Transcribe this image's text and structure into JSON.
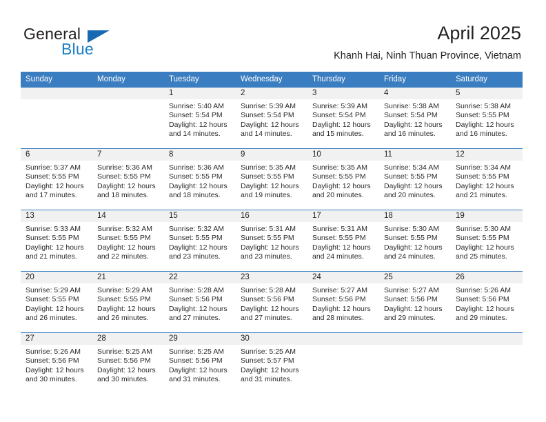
{
  "brand": {
    "name_top": "General",
    "name_bottom": "Blue",
    "color_dark": "#231f20",
    "color_blue": "#1b7fc4"
  },
  "header": {
    "title": "April 2025",
    "subtitle": "Khanh Hai, Ninh Thuan Province, Vietnam",
    "accent_color": "#3a7dc0"
  },
  "weekday_headers": [
    "Sunday",
    "Monday",
    "Tuesday",
    "Wednesday",
    "Thursday",
    "Friday",
    "Saturday"
  ],
  "weeks": [
    [
      {
        "day": "",
        "lines": []
      },
      {
        "day": "",
        "lines": []
      },
      {
        "day": "1",
        "lines": [
          "Sunrise: 5:40 AM",
          "Sunset: 5:54 PM",
          "Daylight: 12 hours",
          "and 14 minutes."
        ]
      },
      {
        "day": "2",
        "lines": [
          "Sunrise: 5:39 AM",
          "Sunset: 5:54 PM",
          "Daylight: 12 hours",
          "and 14 minutes."
        ]
      },
      {
        "day": "3",
        "lines": [
          "Sunrise: 5:39 AM",
          "Sunset: 5:54 PM",
          "Daylight: 12 hours",
          "and 15 minutes."
        ]
      },
      {
        "day": "4",
        "lines": [
          "Sunrise: 5:38 AM",
          "Sunset: 5:54 PM",
          "Daylight: 12 hours",
          "and 16 minutes."
        ]
      },
      {
        "day": "5",
        "lines": [
          "Sunrise: 5:38 AM",
          "Sunset: 5:55 PM",
          "Daylight: 12 hours",
          "and 16 minutes."
        ]
      }
    ],
    [
      {
        "day": "6",
        "lines": [
          "Sunrise: 5:37 AM",
          "Sunset: 5:55 PM",
          "Daylight: 12 hours",
          "and 17 minutes."
        ]
      },
      {
        "day": "7",
        "lines": [
          "Sunrise: 5:36 AM",
          "Sunset: 5:55 PM",
          "Daylight: 12 hours",
          "and 18 minutes."
        ]
      },
      {
        "day": "8",
        "lines": [
          "Sunrise: 5:36 AM",
          "Sunset: 5:55 PM",
          "Daylight: 12 hours",
          "and 18 minutes."
        ]
      },
      {
        "day": "9",
        "lines": [
          "Sunrise: 5:35 AM",
          "Sunset: 5:55 PM",
          "Daylight: 12 hours",
          "and 19 minutes."
        ]
      },
      {
        "day": "10",
        "lines": [
          "Sunrise: 5:35 AM",
          "Sunset: 5:55 PM",
          "Daylight: 12 hours",
          "and 20 minutes."
        ]
      },
      {
        "day": "11",
        "lines": [
          "Sunrise: 5:34 AM",
          "Sunset: 5:55 PM",
          "Daylight: 12 hours",
          "and 20 minutes."
        ]
      },
      {
        "day": "12",
        "lines": [
          "Sunrise: 5:34 AM",
          "Sunset: 5:55 PM",
          "Daylight: 12 hours",
          "and 21 minutes."
        ]
      }
    ],
    [
      {
        "day": "13",
        "lines": [
          "Sunrise: 5:33 AM",
          "Sunset: 5:55 PM",
          "Daylight: 12 hours",
          "and 21 minutes."
        ]
      },
      {
        "day": "14",
        "lines": [
          "Sunrise: 5:32 AM",
          "Sunset: 5:55 PM",
          "Daylight: 12 hours",
          "and 22 minutes."
        ]
      },
      {
        "day": "15",
        "lines": [
          "Sunrise: 5:32 AM",
          "Sunset: 5:55 PM",
          "Daylight: 12 hours",
          "and 23 minutes."
        ]
      },
      {
        "day": "16",
        "lines": [
          "Sunrise: 5:31 AM",
          "Sunset: 5:55 PM",
          "Daylight: 12 hours",
          "and 23 minutes."
        ]
      },
      {
        "day": "17",
        "lines": [
          "Sunrise: 5:31 AM",
          "Sunset: 5:55 PM",
          "Daylight: 12 hours",
          "and 24 minutes."
        ]
      },
      {
        "day": "18",
        "lines": [
          "Sunrise: 5:30 AM",
          "Sunset: 5:55 PM",
          "Daylight: 12 hours",
          "and 24 minutes."
        ]
      },
      {
        "day": "19",
        "lines": [
          "Sunrise: 5:30 AM",
          "Sunset: 5:55 PM",
          "Daylight: 12 hours",
          "and 25 minutes."
        ]
      }
    ],
    [
      {
        "day": "20",
        "lines": [
          "Sunrise: 5:29 AM",
          "Sunset: 5:55 PM",
          "Daylight: 12 hours",
          "and 26 minutes."
        ]
      },
      {
        "day": "21",
        "lines": [
          "Sunrise: 5:29 AM",
          "Sunset: 5:55 PM",
          "Daylight: 12 hours",
          "and 26 minutes."
        ]
      },
      {
        "day": "22",
        "lines": [
          "Sunrise: 5:28 AM",
          "Sunset: 5:56 PM",
          "Daylight: 12 hours",
          "and 27 minutes."
        ]
      },
      {
        "day": "23",
        "lines": [
          "Sunrise: 5:28 AM",
          "Sunset: 5:56 PM",
          "Daylight: 12 hours",
          "and 27 minutes."
        ]
      },
      {
        "day": "24",
        "lines": [
          "Sunrise: 5:27 AM",
          "Sunset: 5:56 PM",
          "Daylight: 12 hours",
          "and 28 minutes."
        ]
      },
      {
        "day": "25",
        "lines": [
          "Sunrise: 5:27 AM",
          "Sunset: 5:56 PM",
          "Daylight: 12 hours",
          "and 29 minutes."
        ]
      },
      {
        "day": "26",
        "lines": [
          "Sunrise: 5:26 AM",
          "Sunset: 5:56 PM",
          "Daylight: 12 hours",
          "and 29 minutes."
        ]
      }
    ],
    [
      {
        "day": "27",
        "lines": [
          "Sunrise: 5:26 AM",
          "Sunset: 5:56 PM",
          "Daylight: 12 hours",
          "and 30 minutes."
        ]
      },
      {
        "day": "28",
        "lines": [
          "Sunrise: 5:25 AM",
          "Sunset: 5:56 PM",
          "Daylight: 12 hours",
          "and 30 minutes."
        ]
      },
      {
        "day": "29",
        "lines": [
          "Sunrise: 5:25 AM",
          "Sunset: 5:56 PM",
          "Daylight: 12 hours",
          "and 31 minutes."
        ]
      },
      {
        "day": "30",
        "lines": [
          "Sunrise: 5:25 AM",
          "Sunset: 5:57 PM",
          "Daylight: 12 hours",
          "and 31 minutes."
        ]
      },
      {
        "day": "",
        "lines": []
      },
      {
        "day": "",
        "lines": []
      },
      {
        "day": "",
        "lines": []
      }
    ]
  ]
}
